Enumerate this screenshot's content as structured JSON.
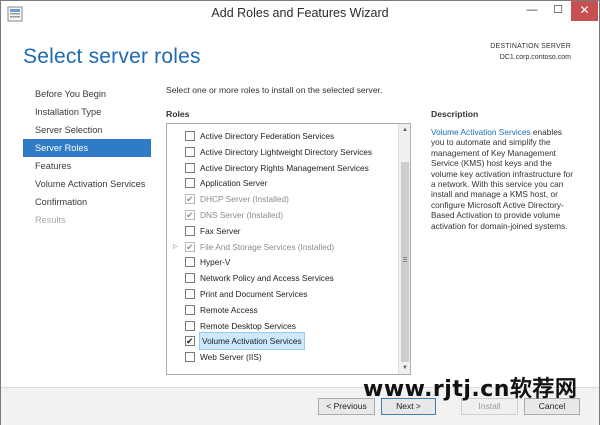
{
  "window": {
    "title": "Add Roles and Features Wizard",
    "controls": {
      "minimize": "—",
      "maximize": "☐",
      "close": "✕"
    }
  },
  "header": {
    "page_title": "Select server roles",
    "destination_label": "DESTINATION SERVER",
    "destination_value": "DC1.corp.contoso.com"
  },
  "nav": {
    "items": [
      {
        "label": "Before You Begin",
        "state": "normal"
      },
      {
        "label": "Installation Type",
        "state": "normal"
      },
      {
        "label": "Server Selection",
        "state": "normal"
      },
      {
        "label": "Server Roles",
        "state": "active"
      },
      {
        "label": "Features",
        "state": "normal"
      },
      {
        "label": "Volume Activation Services",
        "state": "normal"
      },
      {
        "label": "Confirmation",
        "state": "normal"
      },
      {
        "label": "Results",
        "state": "disabled"
      }
    ]
  },
  "main": {
    "instruction": "Select one or more roles to install on the selected server.",
    "roles_header": "Roles",
    "roles": [
      {
        "label": "Active Directory Federation Services",
        "checked": false,
        "disabled": false,
        "expander": false
      },
      {
        "label": "Active Directory Lightweight Directory Services",
        "checked": false,
        "disabled": false,
        "expander": false
      },
      {
        "label": "Active Directory Rights Management Services",
        "checked": false,
        "disabled": false,
        "expander": false
      },
      {
        "label": "Application Server",
        "checked": false,
        "disabled": false,
        "expander": false
      },
      {
        "label": "DHCP Server (Installed)",
        "checked": true,
        "disabled": true,
        "expander": false
      },
      {
        "label": "DNS Server (Installed)",
        "checked": true,
        "disabled": true,
        "expander": false
      },
      {
        "label": "Fax Server",
        "checked": false,
        "disabled": false,
        "expander": false
      },
      {
        "label": "File And Storage Services (Installed)",
        "checked": true,
        "disabled": true,
        "expander": true
      },
      {
        "label": "Hyper-V",
        "checked": false,
        "disabled": false,
        "expander": false
      },
      {
        "label": "Network Policy and Access Services",
        "checked": false,
        "disabled": false,
        "expander": false
      },
      {
        "label": "Print and Document Services",
        "checked": false,
        "disabled": false,
        "expander": false
      },
      {
        "label": "Remote Access",
        "checked": false,
        "disabled": false,
        "expander": false
      },
      {
        "label": "Remote Desktop Services",
        "checked": false,
        "disabled": false,
        "expander": false
      },
      {
        "label": "Volume Activation Services",
        "checked": true,
        "disabled": false,
        "expander": false,
        "selected": true
      },
      {
        "label": "Web Server (IIS)",
        "checked": false,
        "disabled": false,
        "expander": false
      }
    ],
    "scrollbar": {
      "up_arrow": "▲",
      "down_arrow": "▼"
    }
  },
  "description": {
    "header": "Description",
    "link_text": "Volume Activation Services",
    "body": " enables you to automate and simplify the management of Key Management Service (KMS) host keys and the volume key activation infrastructure for a network. With this service you can install and manage a KMS host, or configure Microsoft Active Directory-Based Activation to provide volume activation for domain-joined systems."
  },
  "footer": {
    "previous": "< Previous",
    "next": "Next >",
    "install": "Install",
    "cancel": "Cancel"
  },
  "watermark": "www.rjtj.cn软荐网"
}
